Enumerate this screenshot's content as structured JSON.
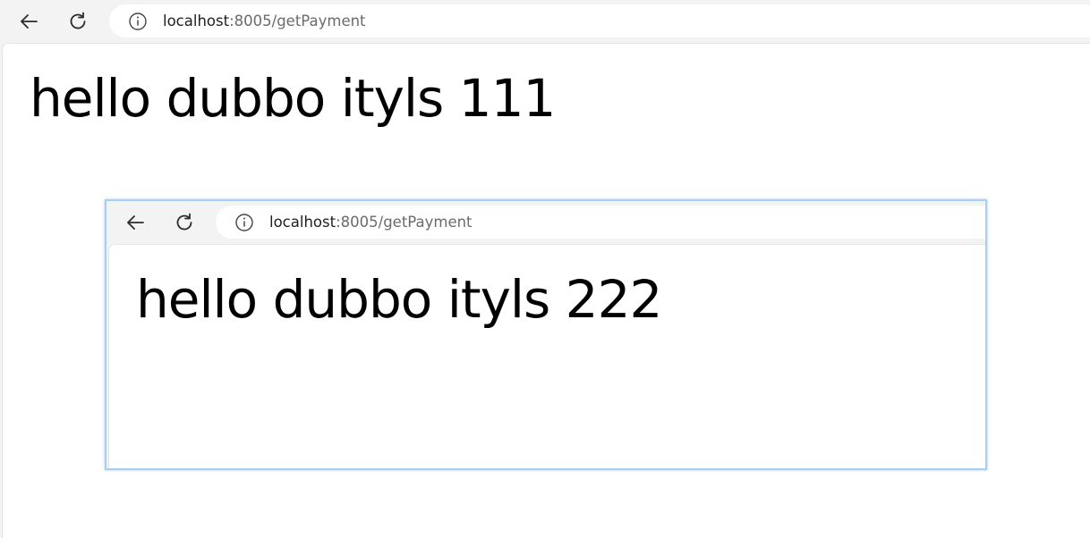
{
  "browser": {
    "back_icon": "back-arrow-icon",
    "reload_icon": "reload-icon",
    "info_icon": "info-icon",
    "url_host": "localhost",
    "url_rest": ":8005/getPayment"
  },
  "page": {
    "heading": "hello dubbo ityls 111"
  },
  "inner_screenshot": {
    "url_host": "localhost",
    "url_rest": ":8005/getPayment",
    "heading": "hello dubbo ityls 222"
  },
  "colors": {
    "chrome_bg": "#f3f3f3",
    "page_bg": "#ffffff",
    "inner_border": "#aacdf3"
  }
}
